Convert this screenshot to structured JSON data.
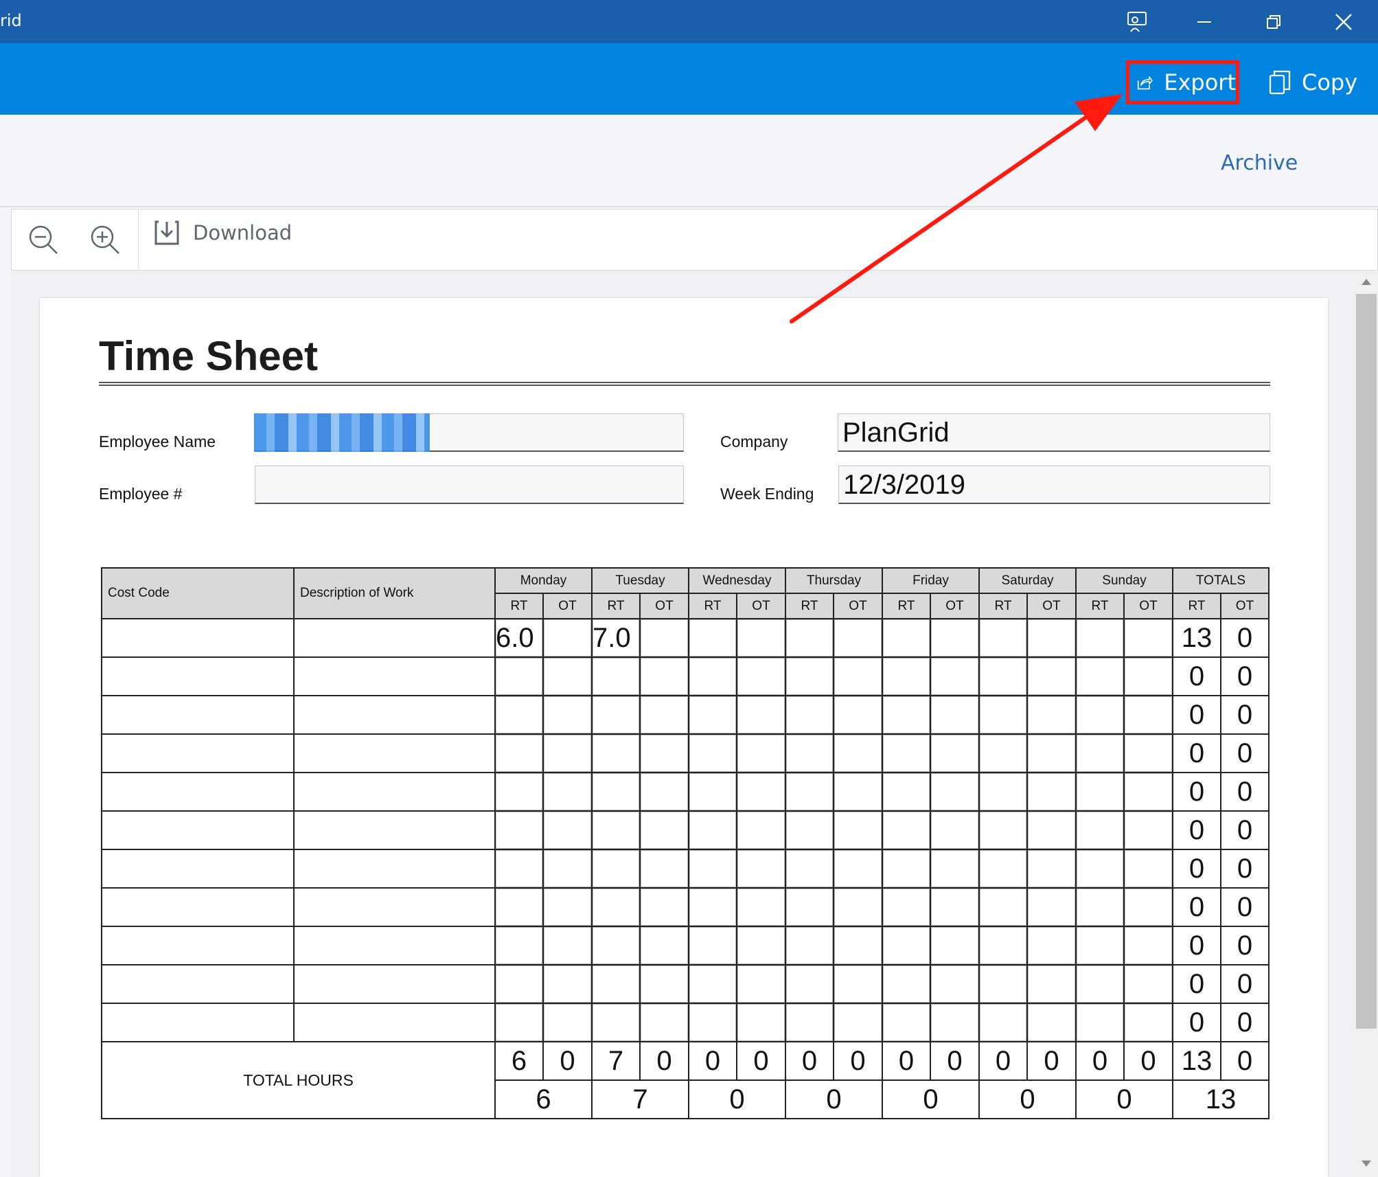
{
  "window": {
    "app_title": "rid",
    "controls": [
      "feedback",
      "minimize",
      "restore",
      "close"
    ]
  },
  "toolbar": {
    "export_label": "Export",
    "copy_label": "Copy"
  },
  "subbar": {
    "archive_label": "Archive"
  },
  "viewer": {
    "download_label": "Download"
  },
  "document": {
    "title": "Time Sheet",
    "fields": {
      "employee_name_label": "Employee Name",
      "employee_name_value": "",
      "employee_number_label": "Employee #",
      "employee_number_value": "",
      "company_label": "Company",
      "company_value": "PlanGrid",
      "week_ending_label": "Week Ending",
      "week_ending_value": "12/3/2019"
    },
    "table": {
      "cost_code_header": "Cost Code",
      "description_header": "Description of Work",
      "days": [
        "Monday",
        "Tuesday",
        "Wednesday",
        "Thursday",
        "Friday",
        "Saturday",
        "Sunday",
        "TOTALS"
      ],
      "rt_label": "RT",
      "ot_label": "OT",
      "rows": [
        {
          "cells": [
            "6.0",
            "",
            "7.0",
            "",
            "",
            "",
            "",
            "",
            "",
            "",
            "",
            "",
            "",
            ""
          ],
          "totals": [
            "13",
            "0"
          ]
        },
        {
          "cells": [
            "",
            "",
            "",
            "",
            "",
            "",
            "",
            "",
            "",
            "",
            "",
            "",
            "",
            ""
          ],
          "totals": [
            "0",
            "0"
          ]
        },
        {
          "cells": [
            "",
            "",
            "",
            "",
            "",
            "",
            "",
            "",
            "",
            "",
            "",
            "",
            "",
            ""
          ],
          "totals": [
            "0",
            "0"
          ]
        },
        {
          "cells": [
            "",
            "",
            "",
            "",
            "",
            "",
            "",
            "",
            "",
            "",
            "",
            "",
            "",
            ""
          ],
          "totals": [
            "0",
            "0"
          ]
        },
        {
          "cells": [
            "",
            "",
            "",
            "",
            "",
            "",
            "",
            "",
            "",
            "",
            "",
            "",
            "",
            ""
          ],
          "totals": [
            "0",
            "0"
          ]
        },
        {
          "cells": [
            "",
            "",
            "",
            "",
            "",
            "",
            "",
            "",
            "",
            "",
            "",
            "",
            "",
            ""
          ],
          "totals": [
            "0",
            "0"
          ]
        },
        {
          "cells": [
            "",
            "",
            "",
            "",
            "",
            "",
            "",
            "",
            "",
            "",
            "",
            "",
            "",
            ""
          ],
          "totals": [
            "0",
            "0"
          ]
        },
        {
          "cells": [
            "",
            "",
            "",
            "",
            "",
            "",
            "",
            "",
            "",
            "",
            "",
            "",
            "",
            ""
          ],
          "totals": [
            "0",
            "0"
          ]
        },
        {
          "cells": [
            "",
            "",
            "",
            "",
            "",
            "",
            "",
            "",
            "",
            "",
            "",
            "",
            "",
            ""
          ],
          "totals": [
            "0",
            "0"
          ]
        },
        {
          "cells": [
            "",
            "",
            "",
            "",
            "",
            "",
            "",
            "",
            "",
            "",
            "",
            "",
            "",
            ""
          ],
          "totals": [
            "0",
            "0"
          ]
        },
        {
          "cells": [
            "",
            "",
            "",
            "",
            "",
            "",
            "",
            "",
            "",
            "",
            "",
            "",
            "",
            ""
          ],
          "totals": [
            "0",
            "0"
          ]
        }
      ],
      "total_hours_label": "TOTAL HOURS",
      "total_rt_ot": [
        "6",
        "0",
        "7",
        "0",
        "0",
        "0",
        "0",
        "0",
        "0",
        "0",
        "0",
        "0",
        "0",
        "0",
        "13",
        "0"
      ],
      "total_per_day": [
        "6",
        "7",
        "0",
        "0",
        "0",
        "0",
        "0",
        "13"
      ]
    }
  },
  "colors": {
    "titlebar": "#1a5fa9",
    "toolbar": "#0184e0",
    "highlight": "#ff1a10",
    "archive_link": "#2c6ab4"
  },
  "icons": {
    "export": "share-icon",
    "copy": "copy-icon",
    "zoom_out": "zoom-out-icon",
    "zoom_in": "zoom-in-icon",
    "download": "download-icon"
  }
}
